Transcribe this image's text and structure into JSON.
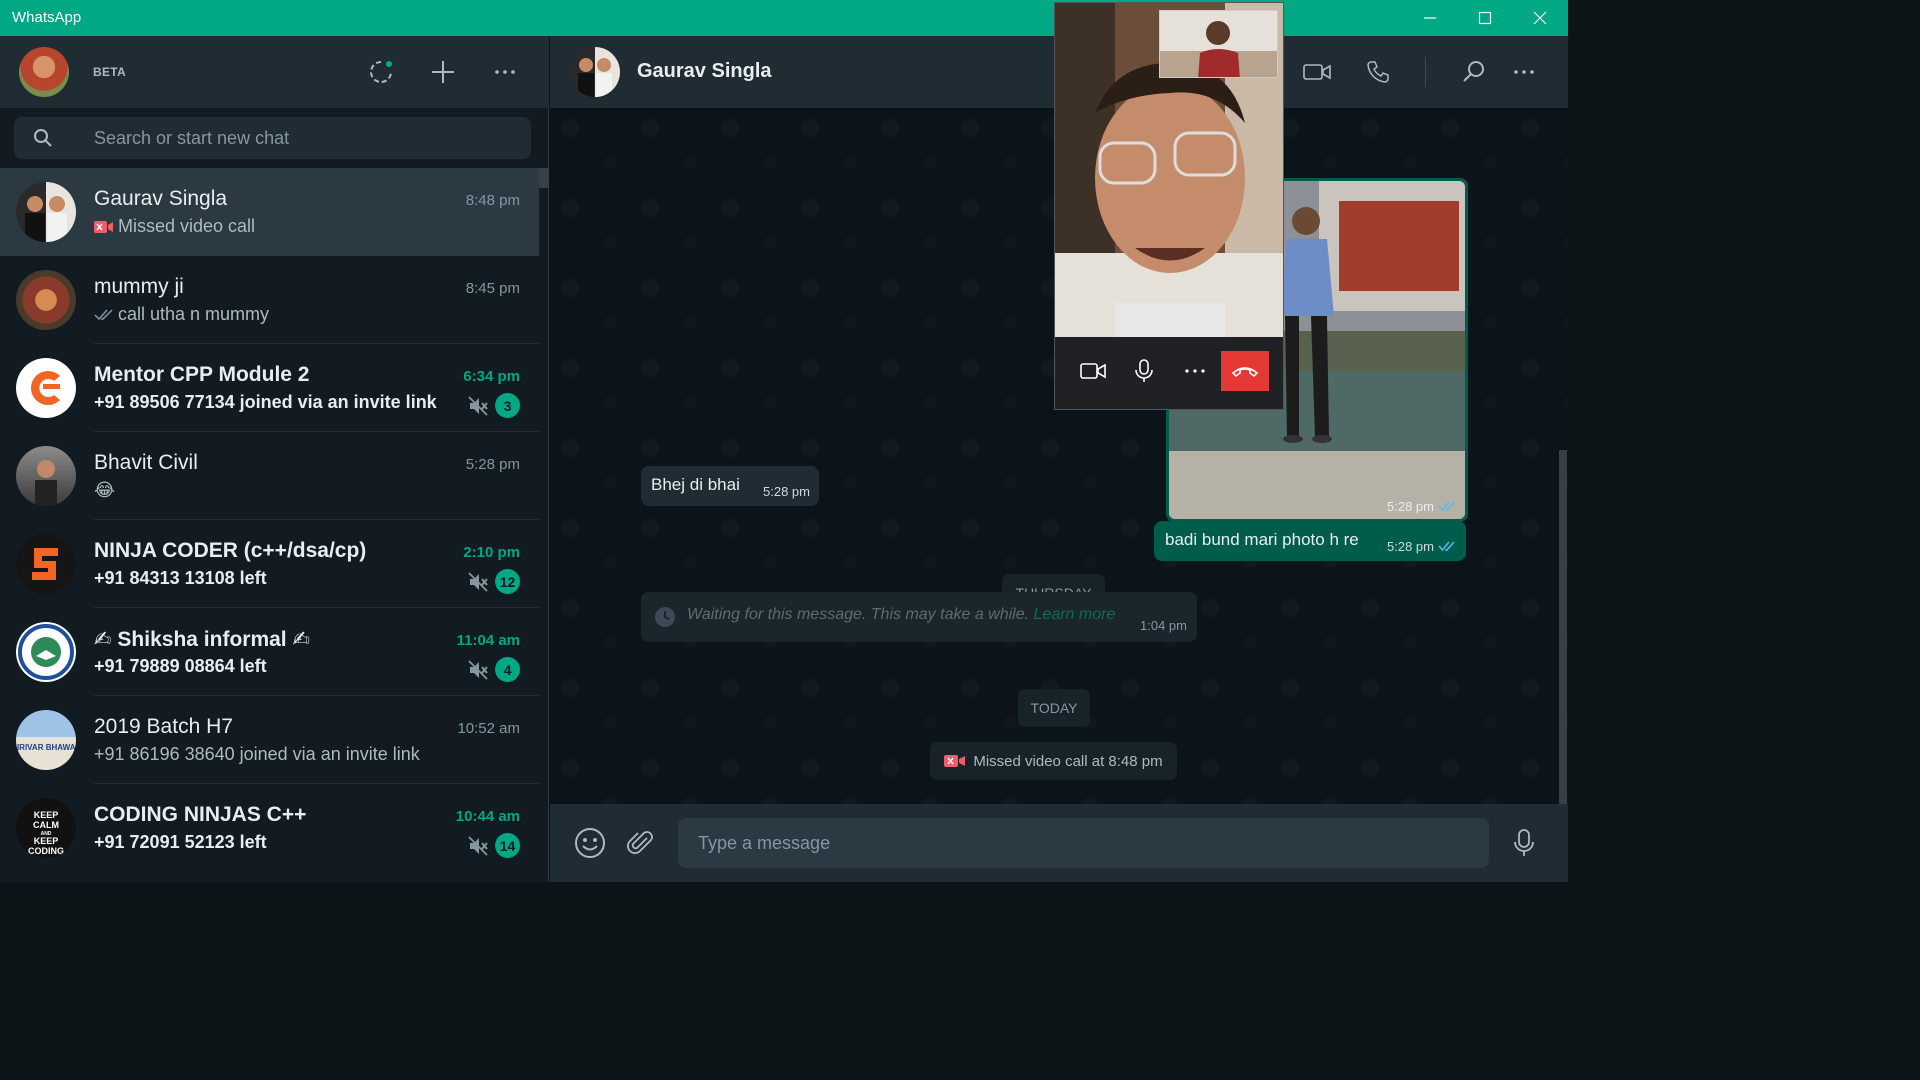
{
  "window": {
    "title": "WhatsApp"
  },
  "left_header": {
    "beta_label": "BETA"
  },
  "search": {
    "placeholder": "Search or start new chat"
  },
  "chats": [
    {
      "name": "Gaurav Singla",
      "time": "8:48 pm",
      "preview": "Missed video call",
      "preview_icon": "missed-video-icon",
      "unread": false,
      "active": true
    },
    {
      "name": "mummy ji",
      "time": "8:45 pm",
      "preview": "call utha n mummy",
      "preview_icon": "double-check-icon",
      "unread": false
    },
    {
      "name": "Mentor CPP Module 2",
      "time": "6:34 pm",
      "preview": "+91 89506 77134 joined via an invite link",
      "unread": true,
      "muted": true,
      "count": "3"
    },
    {
      "name": "Bhavit Civil",
      "time": "5:28 pm",
      "preview": "😂",
      "unread": false
    },
    {
      "name": "NINJA CODER (c++/dsa/cp)",
      "time": "2:10 pm",
      "preview": "+91 84313 13108 left",
      "unread": true,
      "muted": true,
      "count": "12"
    },
    {
      "name": "✍ Shiksha informal ✍",
      "time": "11:04 am",
      "preview": "+91 79889 08864 left",
      "unread": true,
      "muted": true,
      "count": "4"
    },
    {
      "name": "2019 Batch H7",
      "time": "10:52 am",
      "preview": "+91 86196 38640 joined via an invite link",
      "unread": false
    },
    {
      "name": "CODING NINJAS C++",
      "time": "10:44 am",
      "preview": "+91 72091 52123 left",
      "unread": true,
      "muted": true,
      "count": "14"
    }
  ],
  "avatar_text": {
    "girivar": "GIRIVAR BHAWAN",
    "keep_calm": [
      "KEEP",
      "CALM",
      "AND",
      "KEEP",
      "CODING"
    ]
  },
  "conversation": {
    "contact_name": "Gaurav Singla",
    "image_message": {
      "time": "5:28 pm"
    },
    "messages": [
      {
        "dir": "in",
        "text": "Bhej di bhai",
        "time": "5:28 pm"
      },
      {
        "dir": "out",
        "text": "badi bund mari photo h re",
        "time": "5:28 pm"
      }
    ],
    "day_thursday": "THURSDAY",
    "waiting": {
      "text": "Waiting for this message. This may take a while.",
      "link": "Learn more",
      "time": "1:04 pm"
    },
    "day_today": "TODAY",
    "missed_call": "Missed video call at 8:48 pm"
  },
  "composer": {
    "placeholder": "Type a message"
  },
  "colors": {
    "accent": "#00a884",
    "outgoing": "#005c4b",
    "incoming": "#202c33",
    "end_call": "#e53935"
  }
}
